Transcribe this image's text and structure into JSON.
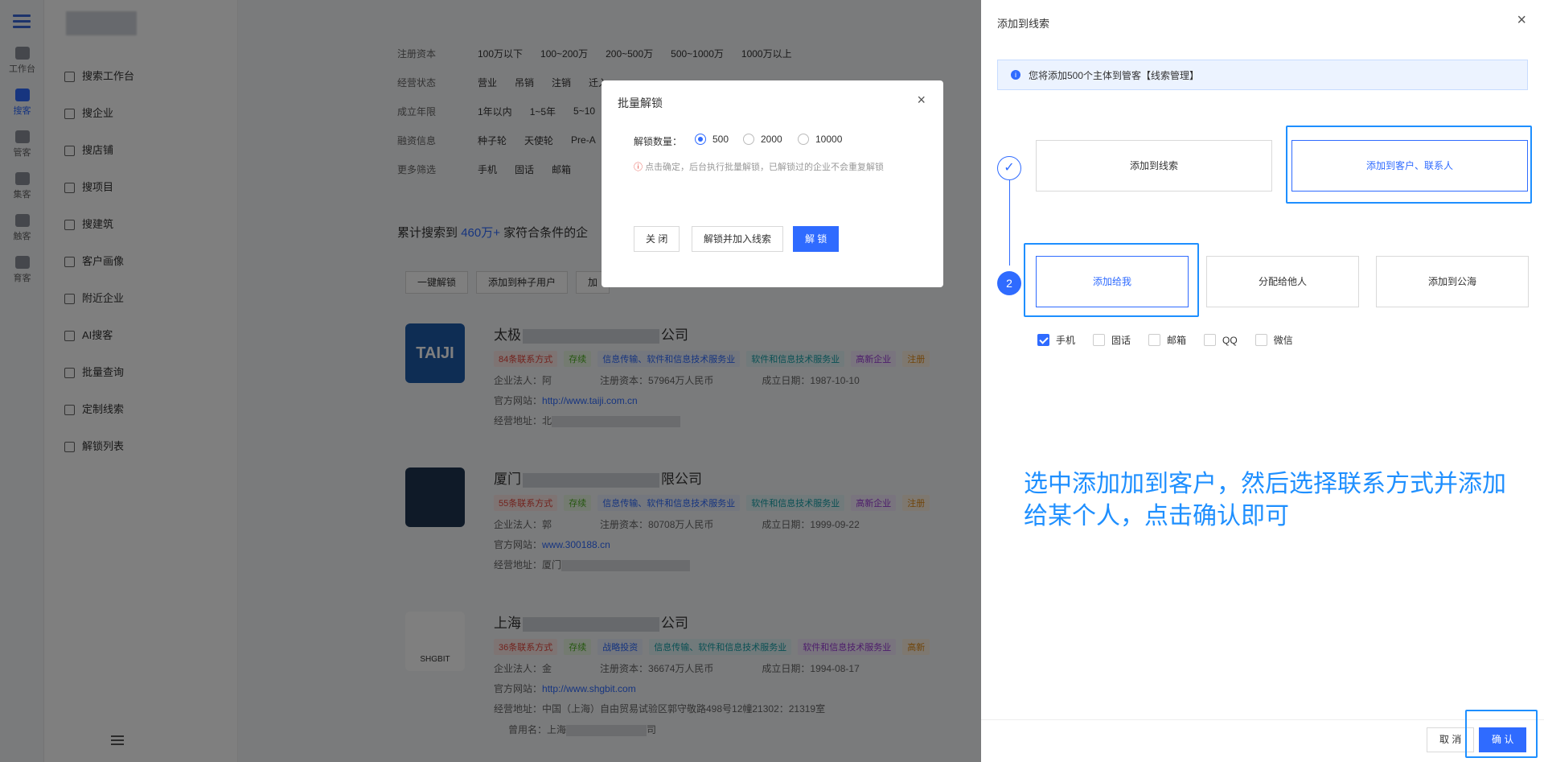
{
  "rail": [
    {
      "label": "工作台",
      "icon": "monitor-icon"
    },
    {
      "label": "搜客",
      "icon": "search-people-icon",
      "active": true
    },
    {
      "label": "管客",
      "icon": "cloud-icon"
    },
    {
      "label": "集客",
      "icon": "group-icon"
    },
    {
      "label": "触客",
      "icon": "user-touch-icon"
    },
    {
      "label": "育客",
      "icon": "users-icon"
    }
  ],
  "sidebar": {
    "items": [
      "搜索工作台",
      "搜企业",
      "搜店铺",
      "搜项目",
      "搜建筑",
      "客户画像",
      "附近企业",
      "AI搜客",
      "批量查询",
      "定制线索",
      "解锁列表"
    ]
  },
  "filters": [
    {
      "label": "注册资本",
      "options": [
        "100万以下",
        "100~200万",
        "200~500万",
        "500~1000万",
        "1000万以上"
      ]
    },
    {
      "label": "经营状态",
      "options": [
        "营业",
        "吊销",
        "注销",
        "迁入"
      ]
    },
    {
      "label": "成立年限",
      "options": [
        "1年以内",
        "1~5年",
        "5~10"
      ]
    },
    {
      "label": "融资信息",
      "options": [
        "种子轮",
        "天使轮",
        "Pre-A"
      ]
    },
    {
      "label": "更多筛选",
      "options": [
        "手机",
        "固话",
        "邮箱"
      ]
    }
  ],
  "summary": {
    "prefix": "累计搜索到",
    "count": "460万+",
    "suffix": "家符合条件的企"
  },
  "actions": [
    "一键解锁",
    "添加到种子用户",
    "加"
  ],
  "companies": [
    {
      "name_start": "太极",
      "name_end": "公司",
      "logo": "TAIJI",
      "tags": [
        "84条联系方式",
        "存续",
        "信息传输、软件和信息技术服务业",
        "软件和信息技术服务业",
        "高新企业",
        "注册"
      ],
      "legal": "企业法人：阿",
      "capital": "注册资本：57964万人民币",
      "date": "成立日期：1987-10-10",
      "site_label": "官方网站：",
      "site": "http://www.taiji.com.cn",
      "addr": "经营地址：北"
    },
    {
      "name_start": "厦门",
      "name_end": "限公司",
      "logo": "",
      "tags": [
        "55条联系方式",
        "存续",
        "信息传输、软件和信息技术服务业",
        "软件和信息技术服务业",
        "高新企业",
        "注册"
      ],
      "legal": "企业法人：郭",
      "capital": "注册资本：80708万人民币",
      "date": "成立日期：1999-09-22",
      "site_label": "官方网站：",
      "site": "www.300188.cn",
      "addr": "经营地址：厦门"
    },
    {
      "name_start": "上海",
      "name_end": "公司",
      "logo": "SHGBIT",
      "tags": [
        "36条联系方式",
        "存续",
        "战略投资",
        "信息传输、软件和信息技术服务业",
        "软件和信息技术服务业",
        "高新"
      ],
      "legal": "企业法人：金",
      "capital": "注册资本：36674万人民币",
      "date": "成立日期：1994-08-17",
      "site_label": "官方网站：",
      "site": "http://www.shgbit.com",
      "addr": "经营地址：中国（上海）自由贸易试验区郭守敬路498号12幢21302：21319室",
      "former": "曾用名：上海",
      "former_end": "司"
    }
  ],
  "unlock_modal": {
    "title": "批量解锁",
    "qty_label": "解锁数量：",
    "options": [
      "500",
      "2000",
      "10000"
    ],
    "selected": "500",
    "warning": "点击确定，后台执行批量解锁，已解锁过的企业不会重复解锁",
    "buttons": {
      "close": "关 闭",
      "unlock_add": "解锁并加入线索",
      "unlock": "解 锁"
    }
  },
  "drawer": {
    "title": "添加到线索",
    "info": "您将添加500个主体到管客【线索管理】",
    "step1": {
      "options": [
        "添加到线索",
        "添加到客户、联系人"
      ],
      "selected": "添加到客户、联系人"
    },
    "step2": {
      "number": "2",
      "options": [
        "添加给我",
        "分配给他人",
        "添加到公海"
      ],
      "selected": "添加给我"
    },
    "contacts": [
      {
        "label": "手机",
        "checked": true
      },
      {
        "label": "固话",
        "checked": false
      },
      {
        "label": "邮箱",
        "checked": false
      },
      {
        "label": "QQ",
        "checked": false
      },
      {
        "label": "微信",
        "checked": false
      }
    ],
    "annotation": "选中添加加到客户，然后选择联系方式并添加给某个人，点击确认即可",
    "cancel": "取 消",
    "confirm": "确 认"
  },
  "colors": {
    "primary": "#2f6bff",
    "highlight": "#1e8fff"
  }
}
